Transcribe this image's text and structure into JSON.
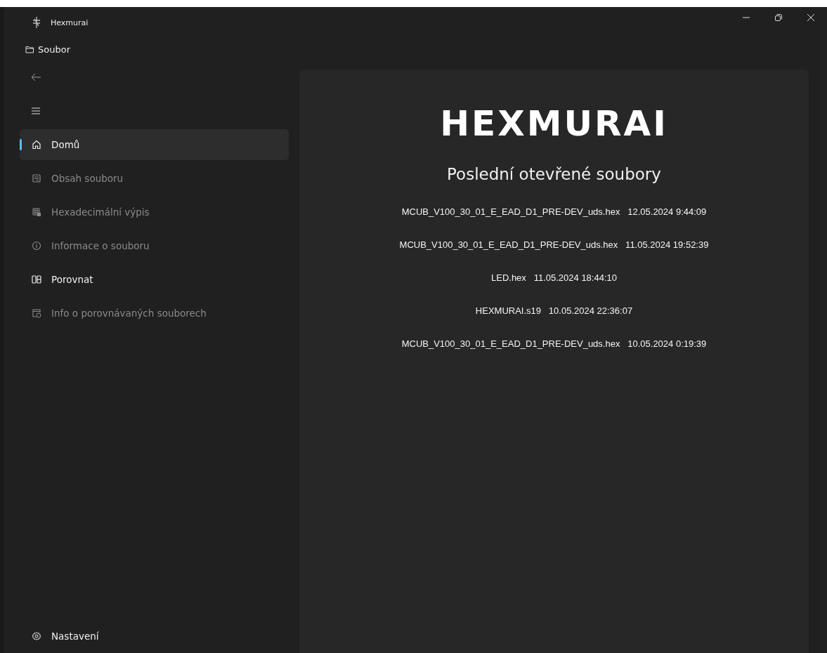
{
  "window": {
    "title": "Hexmurai"
  },
  "menu": {
    "label": "Soubor"
  },
  "nav": [
    {
      "label": "Domů",
      "kind": "home",
      "selected": true,
      "disabled": false
    },
    {
      "label": "Obsah souboru",
      "kind": "document",
      "selected": false,
      "disabled": true
    },
    {
      "label": "Hexadecimální výpis",
      "kind": "table",
      "selected": false,
      "disabled": true
    },
    {
      "label": "Informace o souboru",
      "kind": "info",
      "selected": false,
      "disabled": true
    },
    {
      "label": "Porovnat",
      "kind": "compare",
      "selected": false,
      "disabled": false
    },
    {
      "label": "Info o porovnávaných souborech",
      "kind": "compareinfo",
      "selected": false,
      "disabled": true
    }
  ],
  "settings": {
    "label": "Nastavení"
  },
  "logo": "HEXMURAI",
  "heading": "Poslední otevřené soubory",
  "recent": [
    {
      "file": "MCUB_V100_30_01_E_EAD_D1_PRE-DEV_uds.hex",
      "time": "12.05.2024 9:44:09"
    },
    {
      "file": "MCUB_V100_30_01_E_EAD_D1_PRE-DEV_uds.hex",
      "time": "11.05.2024 19:52:39"
    },
    {
      "file": "LED.hex",
      "time": "11.05.2024 18:44:10"
    },
    {
      "file": "HEXMURAI.s19",
      "time": "10.05.2024 22:36:07"
    },
    {
      "file": "MCUB_V100_30_01_E_EAD_D1_PRE-DEV_uds.hex",
      "time": "10.05.2024 0:19:39"
    }
  ]
}
